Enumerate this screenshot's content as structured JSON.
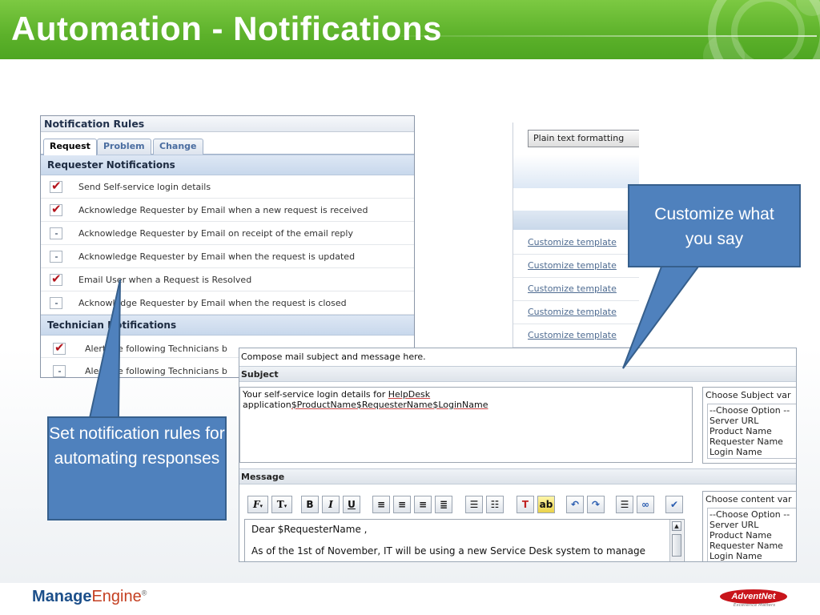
{
  "slide": {
    "title": "Automation - Notifications"
  },
  "rules_panel": {
    "title": "Notification Rules",
    "tabs": [
      {
        "label": "Request",
        "active": true
      },
      {
        "label": "Problem",
        "active": false
      },
      {
        "label": "Change",
        "active": false
      }
    ],
    "requester_section": "Requester Notifications",
    "requester_rules": [
      {
        "label": "Send Self-service login details",
        "checked": true
      },
      {
        "label": "Acknowledge Requester by Email when a new request is received",
        "checked": true
      },
      {
        "label": "Acknowledge Requester by Email on receipt of the email reply",
        "checked": false
      },
      {
        "label": "Acknowledge Requester by Email when the request is updated",
        "checked": false
      },
      {
        "label": "Email User when a Request is Resolved",
        "checked": true
      },
      {
        "label": "Acknowledge Requester by Email when the request is closed",
        "checked": false
      }
    ],
    "technician_section": "Technician Notifications",
    "technician_rules": [
      {
        "label": "Alert the following Technicians b",
        "checked": true
      },
      {
        "label": "Alert the following Technicians b",
        "checked": false
      }
    ]
  },
  "templates_panel": {
    "format_button": "Plain text formatting",
    "links": [
      "Customize template",
      "Customize template",
      "Customize template",
      "Customize template",
      "Customize template"
    ]
  },
  "compose_panel": {
    "intro": "Compose mail subject and message here.",
    "subject_label": "Subject",
    "subject_line1_prefix": "Your self-service login details for ",
    "subject_line1_link": "HelpDesk",
    "subject_line2_prefix": "application",
    "subject_line2_vars": [
      "$ProductName",
      "$RequesterName",
      "$LoginName"
    ],
    "subject_vars": {
      "heading": "Choose Subject var",
      "options": [
        "--Choose Option --",
        "Server URL",
        "Product Name",
        "Requester Name",
        "Login Name"
      ]
    },
    "message_label": "Message",
    "message_line1": "Dear $RequesterName ,",
    "message_line2": "As of the 1st of November, IT will be using a new Service Desk system to manage",
    "content_vars": {
      "heading": "Choose content var",
      "options": [
        "--Choose Option --",
        "Server URL",
        "Product Name",
        "Requester Name",
        "Login Name"
      ]
    },
    "toolbar": [
      "font-family-icon",
      "font-size-icon",
      "bold-icon",
      "italic-icon",
      "underline-icon",
      "align-left-icon",
      "align-center-icon",
      "align-right-icon",
      "justify-icon",
      "numbered-list-icon",
      "bullet-list-icon",
      "text-color-icon",
      "highlight-icon",
      "undo-icon",
      "redo-icon",
      "horizontal-rule-icon",
      "link-icon",
      "spellcheck-icon"
    ]
  },
  "callouts": {
    "left": "Set notification rules for automating responses",
    "right": "Customize what you say"
  },
  "footer": {
    "brand_left_1": "Manage",
    "brand_left_2": "Engine",
    "brand_left_reg": "®",
    "brand_right": "AdventNet",
    "brand_right_tagline": "Excellence Matters"
  },
  "colors": {
    "header_green": "#5cb12a",
    "callout_blue": "#4f81bd",
    "check_red": "#b3131b"
  }
}
